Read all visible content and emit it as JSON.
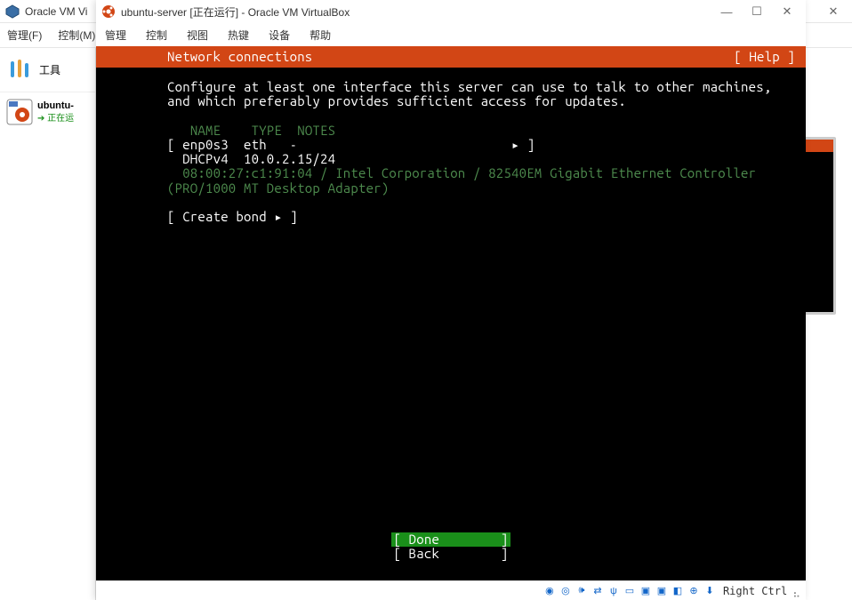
{
  "manager": {
    "title": "Oracle VM Vi",
    "menus": {
      "file": "管理(F)",
      "control": "控制(M)"
    },
    "sidebar": {
      "tools_label": "工具",
      "vm_name": "ubuntu-",
      "vm_status": "正在运"
    },
    "winbtns": {
      "close_glyph": "✕"
    }
  },
  "vm": {
    "title": "ubuntu-server [正在运行] - Oracle VM VirtualBox",
    "menus": {
      "manage": "管理",
      "control": "控制",
      "view": "视图",
      "hotkeys": "热键",
      "devices": "设备",
      "help": "帮助"
    },
    "winbtns": {
      "min": "—",
      "max": "☐",
      "close": "✕"
    }
  },
  "installer": {
    "header_title": "Network connections",
    "help_label": "[ Help ]",
    "intro_l1": "Configure at least one interface this server can use to talk to other machines,",
    "intro_l2": "and which preferably provides sufficient access for updates.",
    "cols": {
      "name": "NAME",
      "type": "TYPE",
      "notes": "NOTES"
    },
    "iface_row": "[ enp0s3  eth   -                            ▸ ]",
    "dhcp_row": "  DHCPv4  10.0.2.15/24",
    "hw_l1": "  08:00:27:c1:91:04 / Intel Corporation / 82540EM Gigabit Ethernet Controller",
    "hw_l2": "(PRO/1000 MT Desktop Adapter)",
    "create_bond": "[ Create bond ▸ ]",
    "btn_done": "[ Done        ]",
    "btn_back": "[ Back        ]"
  },
  "statusbar": {
    "host_key": "Right Ctrl"
  }
}
